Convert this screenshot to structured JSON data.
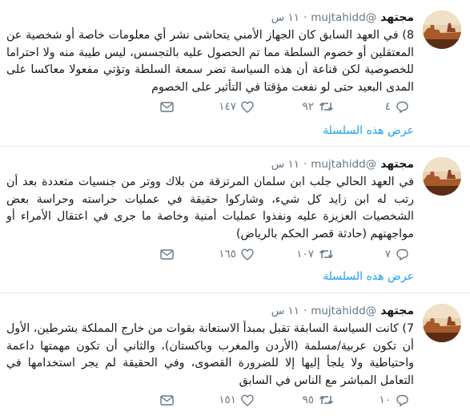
{
  "tweets": [
    {
      "name": "مجتهد",
      "handle": "@mujtahidd",
      "time": "١١ س",
      "text": "8) في العهد السابق كان الجهاز الأمني يتحاشى نشر أي معلومات خاصة أو شخصية عن المعتقلين أو خصوم السلطة مما تم الحصول عليه بالتجسس، ليس طيبة منه ولا احتراما للخصوصية لكن قناعة أن هذه السياسة تضر سمعة السلطة وتؤتي مفعولا معاكسا على المدى البعيد حتى لو نفعت مؤقتا في التأثير على الخصوم",
      "replies": "٤",
      "retweets": "٩٢",
      "likes": "١٤٧",
      "show_thread": "عرض هذه السلسلة"
    },
    {
      "name": "مجتهد",
      "handle": "@mujtahidd",
      "time": "١١ س",
      "text": "في العهد الحالي جلب ابن سلمان المرتزقة من بلاك ووتر من جنسيات متعددة بعد أن رتب له ابن زايد كل شيء، وشاركوا حقيقة في عمليات حراسته وحراسة بعض الشخصيات العزيزة عليه ونفذوا عمليات أمنية وخاصة ما جرى في اعتقال الأمراء أو مواجهتهم (حادثة قصر الحكم بالرياض)",
      "replies": "٧",
      "retweets": "١٠٧",
      "likes": "١٦٥",
      "show_thread": "عرض هذه السلسلة"
    },
    {
      "name": "مجتهد",
      "handle": "@mujtahidd",
      "time": "١١ س",
      "text": "7) كانت السياسة السابقة تقبل بمبدأ الاستعانة بقوات من خارج المملكة بشرطين، الأول أن تكون عربية/مسلمة (الأردن والمغرب وباكستان)، والثاني أن تكون مهمتها داعمة واحتياطية ولا يلجأ إليها إلا للضرورة القصوى، وفي الحقيقة لم يجر استخدامها في التعامل المباشر مع الناس في السابق",
      "replies": "١٠",
      "retweets": "٩٥",
      "likes": "١٥١",
      "show_thread": ""
    }
  ],
  "icons": {
    "reply": "reply-icon",
    "retweet": "retweet-icon",
    "like": "heart-icon",
    "dm": "envelope-icon",
    "avatar": "desert-landscape-avatar"
  },
  "colors": {
    "link": "#1da1f2",
    "muted": "#657786",
    "border": "#e6ecf0"
  }
}
